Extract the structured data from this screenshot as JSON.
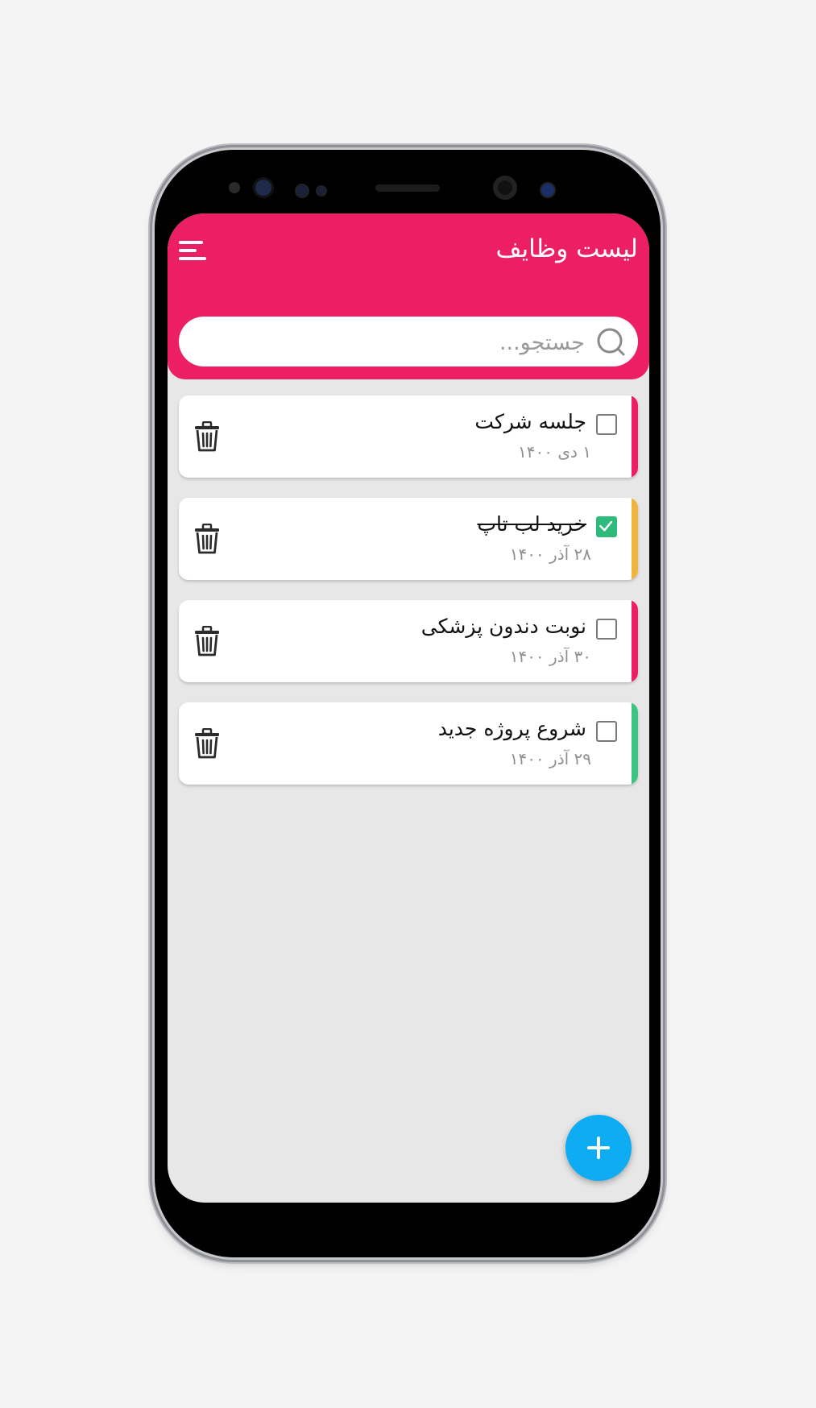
{
  "header": {
    "title": "لیست وظایف",
    "color": "#ec1f64"
  },
  "search": {
    "placeholder": "جستجو..."
  },
  "tasks": [
    {
      "title": "جلسه شرکت",
      "date": "۱ دی ۱۴۰۰",
      "done": false,
      "color": "#ec1f64"
    },
    {
      "title": "خرید لب تاپ",
      "date": "۲۸ آذر ۱۴۰۰",
      "done": true,
      "color": "#f0b43f"
    },
    {
      "title": "نوبت دندون پزشکی",
      "date": "۳۰ آذر ۱۴۰۰",
      "done": false,
      "color": "#ec1f64"
    },
    {
      "title": "شروع پروژه جدید",
      "date": "۲۹ آذر ۱۴۰۰",
      "done": false,
      "color": "#3cc281"
    }
  ],
  "fab": {
    "icon": "plus-icon",
    "color": "#0eacf2"
  },
  "icons": {
    "menu": "menu-icon",
    "search": "search-icon",
    "delete": "trash-icon",
    "check": "check-icon"
  }
}
